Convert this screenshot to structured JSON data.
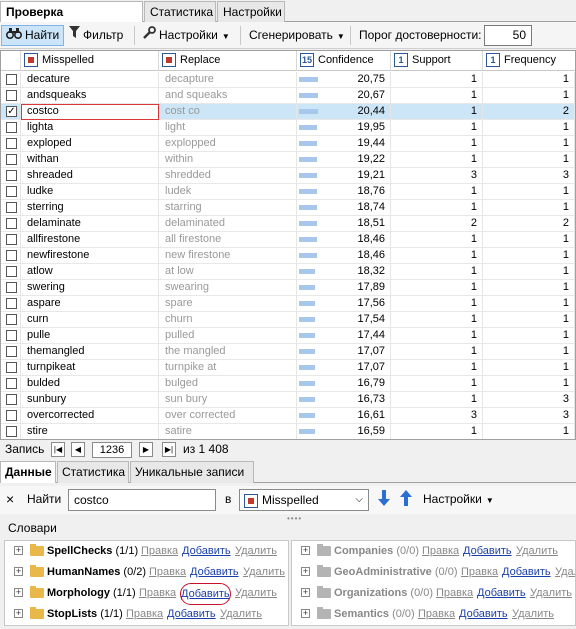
{
  "top_tabs": [
    "Проверка орфографии",
    "Статистика",
    "Настройки"
  ],
  "toolbar": {
    "find": "Найти",
    "filter": "Фильтр",
    "settings": "Настройки",
    "generate": "Сгенерировать",
    "threshold_label": "Порог достоверности:",
    "threshold_value": "50"
  },
  "columns": {
    "misspelled": "Misspelled",
    "replace": "Replace",
    "confidence": "Confidence",
    "support": "Support",
    "frequency": "Frequency"
  },
  "rows": [
    {
      "checked": false,
      "misspelled": "decature",
      "replace": "decapture",
      "confidence": "20,75",
      "bar": 0.12,
      "support": "1",
      "frequency": "1"
    },
    {
      "checked": false,
      "misspelled": "andsqueaks",
      "replace": "and squeaks",
      "confidence": "20,67",
      "bar": 0.12,
      "support": "1",
      "frequency": "1"
    },
    {
      "checked": true,
      "misspelled": "costco",
      "replace": "cost co",
      "confidence": "20,44",
      "bar": 0.12,
      "support": "1",
      "frequency": "2"
    },
    {
      "checked": false,
      "misspelled": "lighta",
      "replace": "light",
      "confidence": "19,95",
      "bar": 0.11,
      "support": "1",
      "frequency": "1"
    },
    {
      "checked": false,
      "misspelled": "exploped",
      "replace": "explopped",
      "confidence": "19,44",
      "bar": 0.11,
      "support": "1",
      "frequency": "1"
    },
    {
      "checked": false,
      "misspelled": "withan",
      "replace": "within",
      "confidence": "19,22",
      "bar": 0.11,
      "support": "1",
      "frequency": "1"
    },
    {
      "checked": false,
      "misspelled": "shreaded",
      "replace": "shredded",
      "confidence": "19,21",
      "bar": 0.11,
      "support": "3",
      "frequency": "3"
    },
    {
      "checked": false,
      "misspelled": "ludke",
      "replace": "ludek",
      "confidence": "18,76",
      "bar": 0.11,
      "support": "1",
      "frequency": "1"
    },
    {
      "checked": false,
      "misspelled": "sterring",
      "replace": "starring",
      "confidence": "18,74",
      "bar": 0.11,
      "support": "1",
      "frequency": "1"
    },
    {
      "checked": false,
      "misspelled": "delaminate",
      "replace": "delaminated",
      "confidence": "18,51",
      "bar": 0.11,
      "support": "2",
      "frequency": "2"
    },
    {
      "checked": false,
      "misspelled": "allfirestone",
      "replace": "all firestone",
      "confidence": "18,46",
      "bar": 0.11,
      "support": "1",
      "frequency": "1"
    },
    {
      "checked": false,
      "misspelled": "newfirestone",
      "replace": "new firestone",
      "confidence": "18,46",
      "bar": 0.11,
      "support": "1",
      "frequency": "1"
    },
    {
      "checked": false,
      "misspelled": "atlow",
      "replace": "at low",
      "confidence": "18,32",
      "bar": 0.1,
      "support": "1",
      "frequency": "1"
    },
    {
      "checked": false,
      "misspelled": "swering",
      "replace": "swearing",
      "confidence": "17,89",
      "bar": 0.1,
      "support": "1",
      "frequency": "1"
    },
    {
      "checked": false,
      "misspelled": "aspare",
      "replace": "spare",
      "confidence": "17,56",
      "bar": 0.1,
      "support": "1",
      "frequency": "1"
    },
    {
      "checked": false,
      "misspelled": "curn",
      "replace": "churn",
      "confidence": "17,54",
      "bar": 0.1,
      "support": "1",
      "frequency": "1"
    },
    {
      "checked": false,
      "misspelled": "pulle",
      "replace": "pulled",
      "confidence": "17,44",
      "bar": 0.1,
      "support": "1",
      "frequency": "1"
    },
    {
      "checked": false,
      "misspelled": "themangled",
      "replace": "the mangled",
      "confidence": "17,07",
      "bar": 0.1,
      "support": "1",
      "frequency": "1"
    },
    {
      "checked": false,
      "misspelled": "turnpikeat",
      "replace": "turnpike at",
      "confidence": "17,07",
      "bar": 0.1,
      "support": "1",
      "frequency": "1"
    },
    {
      "checked": false,
      "misspelled": "bulded",
      "replace": "bulged",
      "confidence": "16,79",
      "bar": 0.1,
      "support": "1",
      "frequency": "1"
    },
    {
      "checked": false,
      "misspelled": "sunbury",
      "replace": "sun bury",
      "confidence": "16,73",
      "bar": 0.1,
      "support": "1",
      "frequency": "3"
    },
    {
      "checked": false,
      "misspelled": "overcorrected",
      "replace": "over corrected",
      "confidence": "16,61",
      "bar": 0.1,
      "support": "3",
      "frequency": "3"
    },
    {
      "checked": false,
      "misspelled": "stire",
      "replace": "satire",
      "confidence": "16,59",
      "bar": 0.1,
      "support": "1",
      "frequency": "1"
    }
  ],
  "nav": {
    "label": "Запись",
    "current": "1236",
    "total": "из 1 408"
  },
  "bottom_tabs": [
    "Данные",
    "Статистика",
    "Уникальные записи"
  ],
  "findbar": {
    "close": "×",
    "label": "Найти",
    "value": "costco",
    "in_label": "в",
    "column": "Misspelled",
    "settings": "Настройки"
  },
  "dictionaries": {
    "title": "Словари",
    "edit": "Правка",
    "add": "Добавить",
    "remove": "Удалить",
    "left": [
      {
        "name": "SpellChecks",
        "count": "(1/1)"
      },
      {
        "name": "HumanNames",
        "count": "(0/2)"
      },
      {
        "name": "Morphology",
        "count": "(1/1)"
      },
      {
        "name": "StopLists",
        "count": "(1/1)"
      }
    ],
    "right": [
      {
        "name": "Companies",
        "count": "(0/0)"
      },
      {
        "name": "GeoAdministrative",
        "count": "(0/0)"
      },
      {
        "name": "Organizations",
        "count": "(0/0)"
      },
      {
        "name": "Semantics",
        "count": "(0/0)"
      }
    ]
  },
  "colors": {
    "selection": "#cde6f7",
    "link": "#1a3ea8",
    "highlight_circle": "#c8102e",
    "confidence_bar": "#a7c8ec"
  }
}
